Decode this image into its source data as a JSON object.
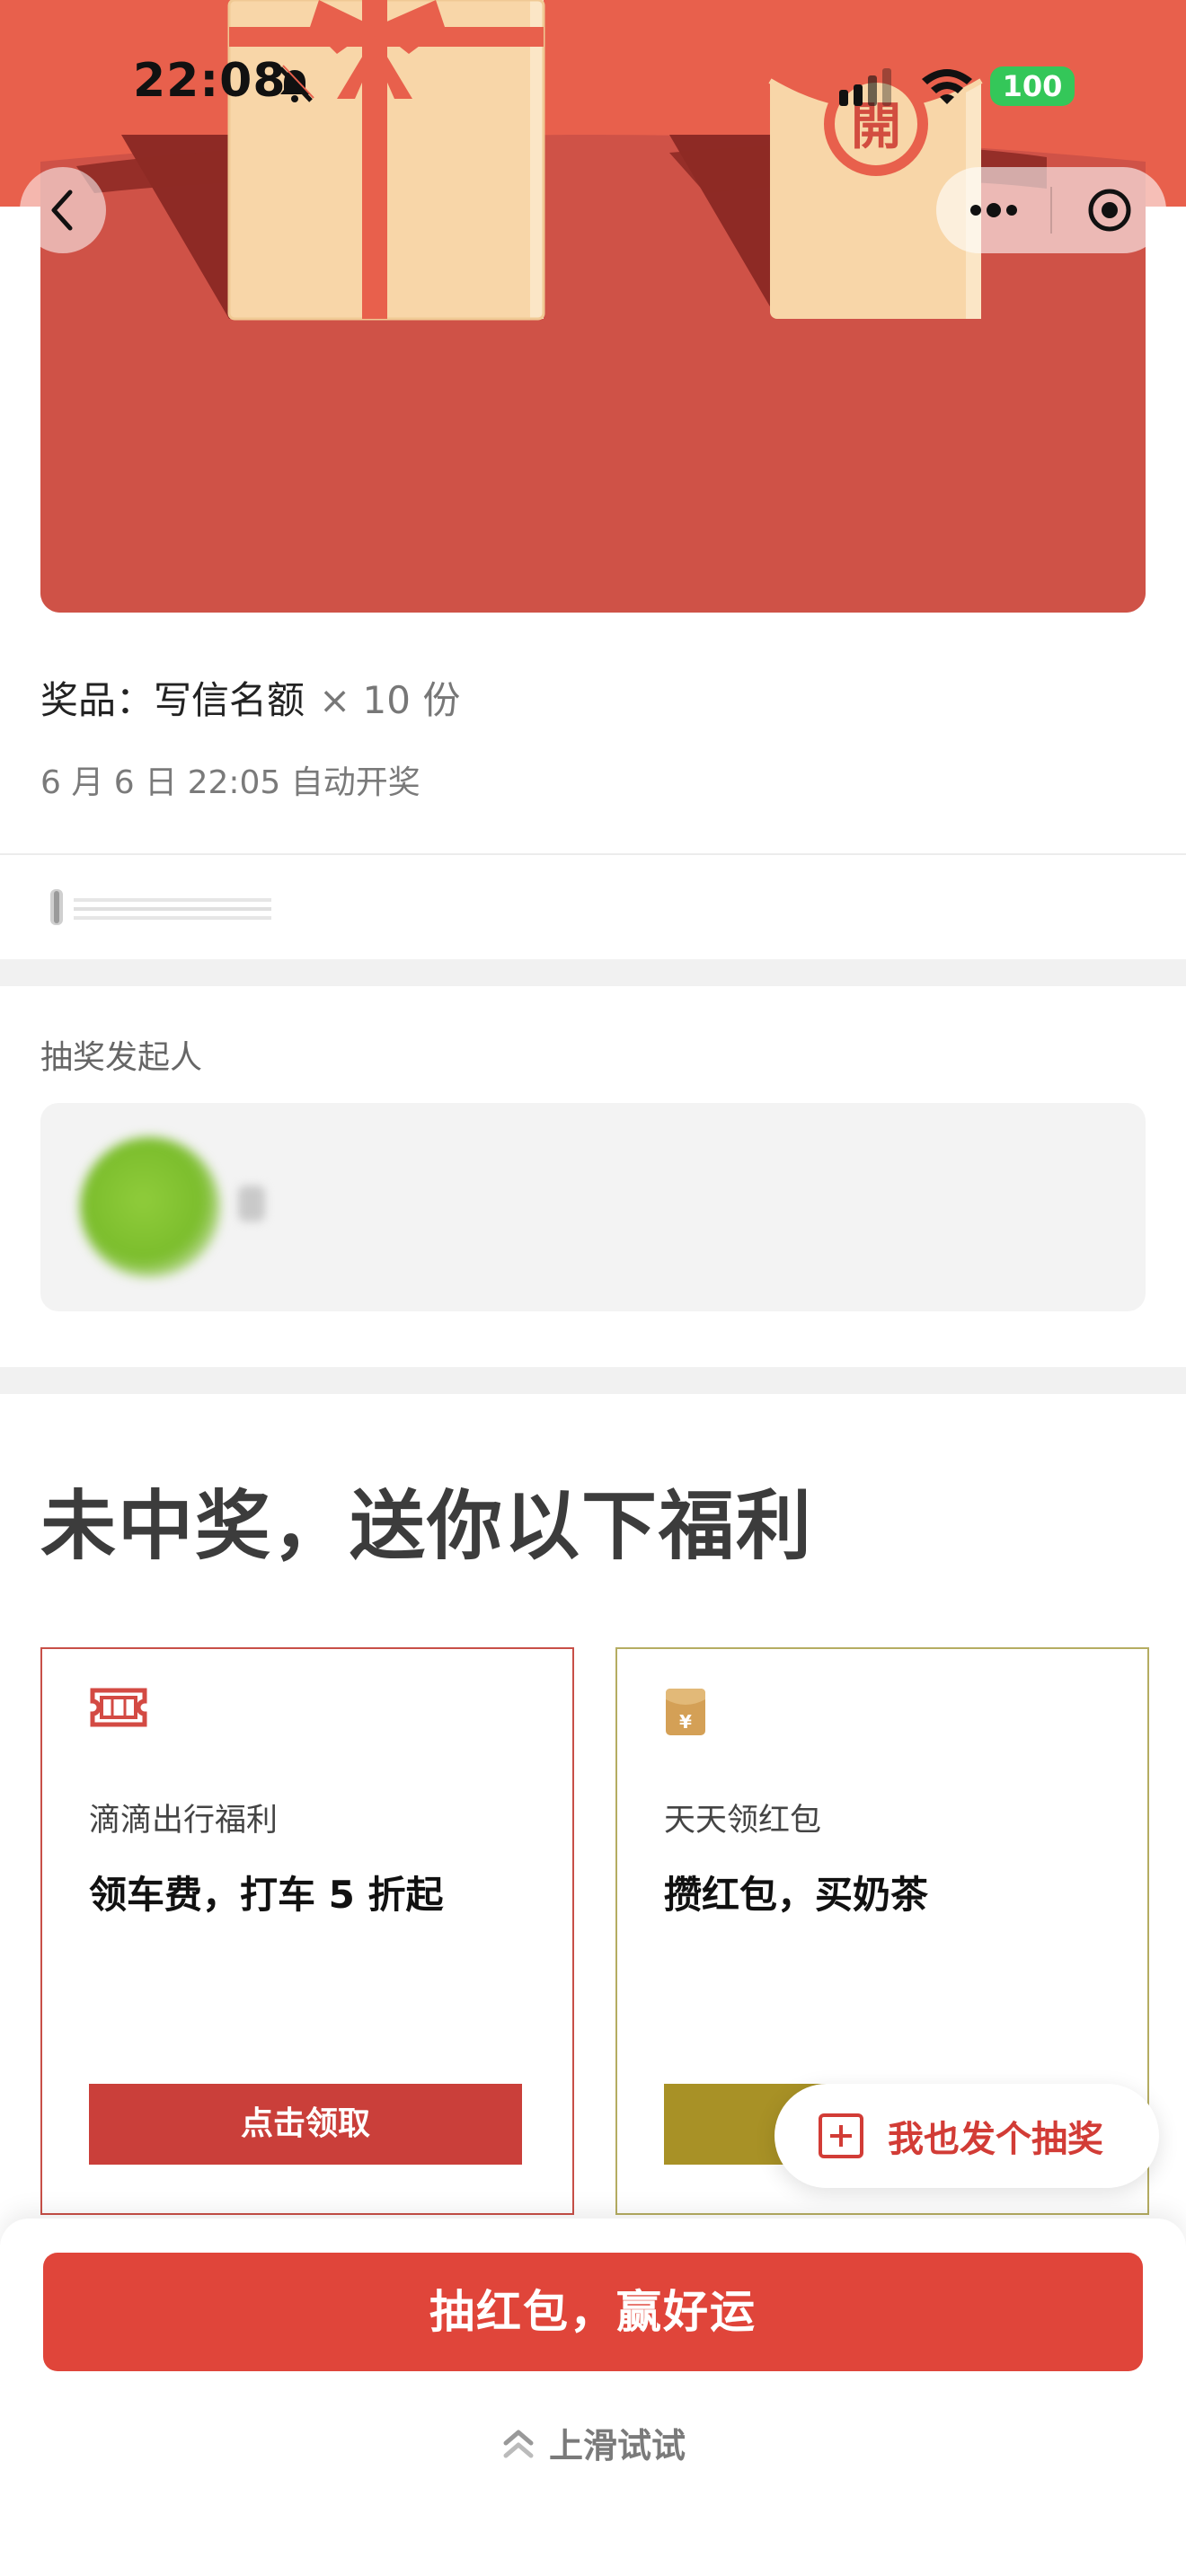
{
  "status_bar": {
    "time": "22:08",
    "battery": "100"
  },
  "hero": {
    "seal_char": "開"
  },
  "prize": {
    "label": "奖品：写信名额",
    "quantity": "× 10 份",
    "open_time": "6 月 6 日 22:05 自动开奖"
  },
  "organizer": {
    "label": "抽奖发起人"
  },
  "welfare": {
    "heading": "未中奖，送你以下福利",
    "cards": [
      {
        "subtitle": "滴滴出行福利",
        "title": "领车费，打车 5 折起",
        "button": "点击领取",
        "color": "#ca3f3a"
      },
      {
        "subtitle": "天天领红包",
        "title": "攒红包，买奶茶",
        "button": "",
        "color": "#a89126"
      }
    ]
  },
  "floating": {
    "start_lottery": "我也发个抽奖"
  },
  "bottom": {
    "draw_button": "抽红包，赢好运",
    "swipe_hint": "上滑试试"
  },
  "colors": {
    "accent_red": "#e0453a",
    "hero_red": "#cf5247",
    "gift_beige": "#f8d6a8",
    "battery_green": "#34c759"
  }
}
